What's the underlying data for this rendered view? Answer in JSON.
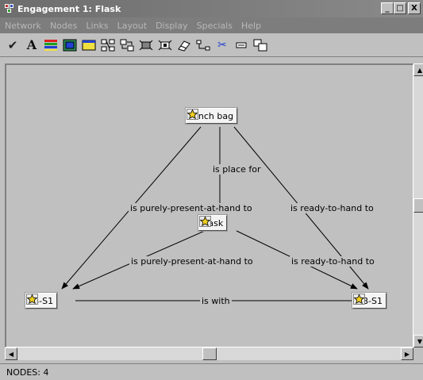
{
  "window": {
    "title": "Engagement 1: Flask",
    "minimize_glyph": "_",
    "maximize_glyph": "□",
    "close_glyph": "X"
  },
  "menu": {
    "items": [
      "Network",
      "Nodes",
      "Links",
      "Layout",
      "Display",
      "Specials",
      "Help"
    ]
  },
  "toolbar": {
    "tools": [
      {
        "name": "check-tool-icon",
        "glyph": "✔"
      },
      {
        "name": "font-tool-icon",
        "glyph": "A"
      },
      {
        "name": "color-lines-tool-icon",
        "glyph": ""
      },
      {
        "name": "node-color-tool-icon",
        "glyph": ""
      },
      {
        "name": "rectangle-tool-icon",
        "glyph": ""
      },
      {
        "name": "layout-tree-tool-icon",
        "glyph": ""
      },
      {
        "name": "layout-swap-tool-icon",
        "glyph": ""
      },
      {
        "name": "cluster-tool-icon",
        "glyph": ""
      },
      {
        "name": "cluster-select-tool-icon",
        "glyph": ""
      },
      {
        "name": "eraser-tool-icon",
        "glyph": ""
      },
      {
        "name": "connect-tool-icon",
        "glyph": ""
      },
      {
        "name": "cut-tool-icon",
        "glyph": "✂"
      },
      {
        "name": "copy-tool-icon",
        "glyph": ""
      },
      {
        "name": "paste-tool-icon",
        "glyph": ""
      }
    ],
    "accent_colors": {
      "red": "#e02020",
      "green": "#20a020",
      "blue": "#2040d0",
      "yellow": "#f0e040"
    }
  },
  "graph": {
    "nodes": [
      {
        "id": "lunch-bag",
        "label": "Lunch bag"
      },
      {
        "id": "flask",
        "label": "Flask"
      },
      {
        "id": "pb-s1",
        "label": "PB-S1"
      },
      {
        "id": "mb-s1",
        "label": "MB-S1"
      }
    ],
    "edges": [
      {
        "from": "lunch-bag",
        "to": "flask",
        "label": "is place for"
      },
      {
        "from": "lunch-bag",
        "to": "pb-s1",
        "label": "is purely-present-at-hand to"
      },
      {
        "from": "lunch-bag",
        "to": "mb-s1",
        "label": "is ready-to-hand to"
      },
      {
        "from": "flask",
        "to": "pb-s1",
        "label": "is purely-present-at-hand to"
      },
      {
        "from": "flask",
        "to": "mb-s1",
        "label": "is ready-to-hand to"
      },
      {
        "from": "pb-s1",
        "to": "mb-s1",
        "label": "is with"
      }
    ]
  },
  "scrollbars": {
    "up_glyph": "▲",
    "down_glyph": "▼",
    "left_glyph": "◀",
    "right_glyph": "▶"
  },
  "status": {
    "text": "NODES: 4"
  }
}
